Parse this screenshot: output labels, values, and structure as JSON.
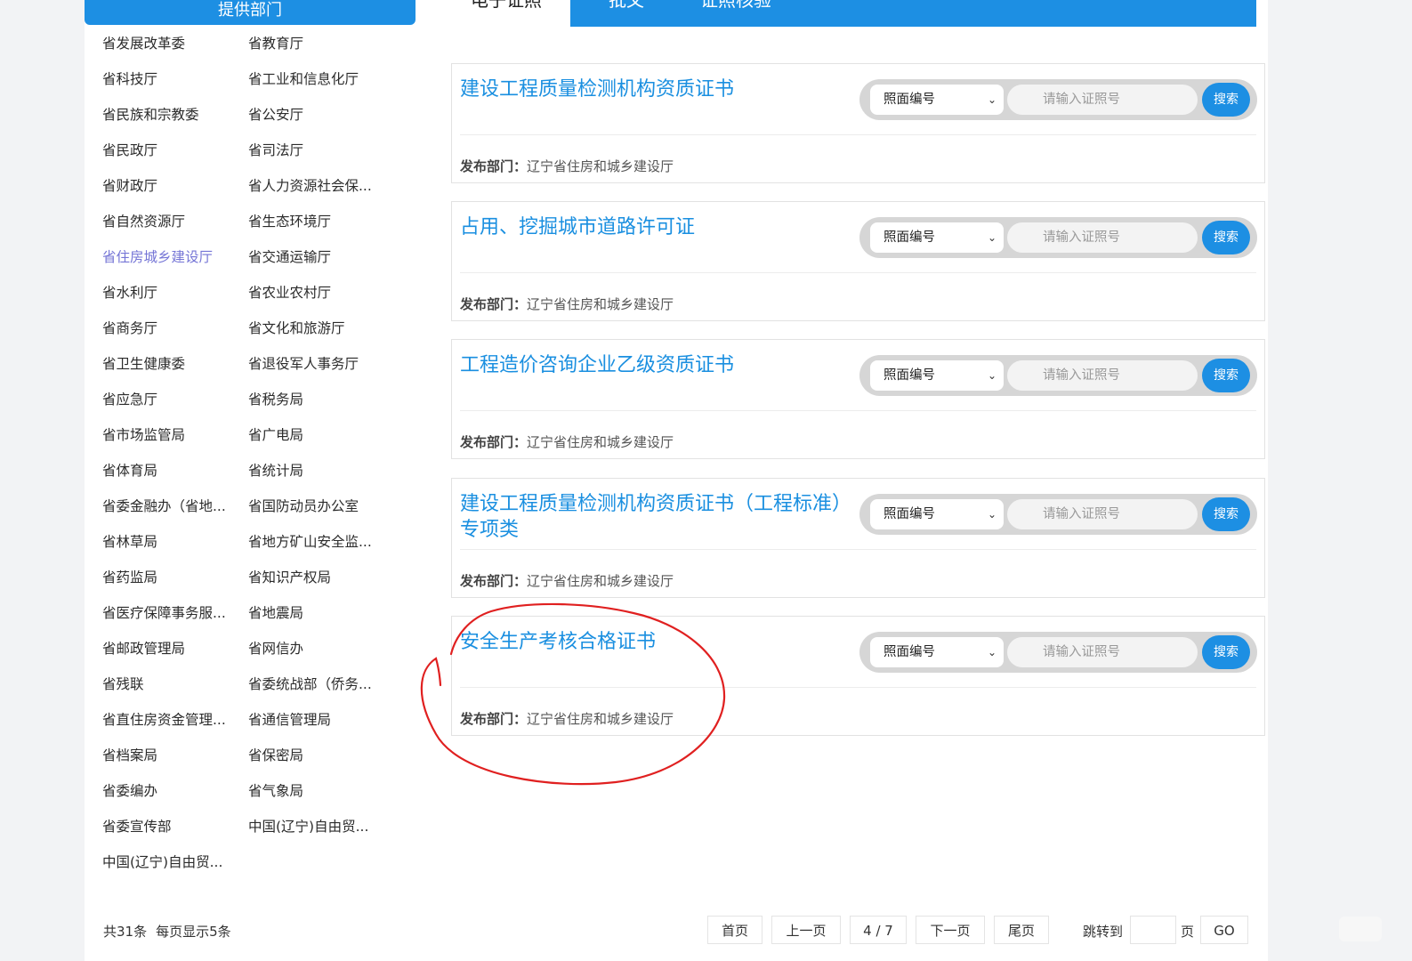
{
  "left_panel": {
    "header": "提供部门",
    "departments": [
      "省发展改革委",
      "省教育厅",
      "省科技厅",
      "省工业和信息化厅",
      "省民族和宗教委",
      "省公安厅",
      "省民政厅",
      "省司法厅",
      "省财政厅",
      "省人力资源社会保...",
      "省自然资源厅",
      "省生态环境厅",
      "省住房城乡建设厅",
      "省交通运输厅",
      "省水利厅",
      "省农业农村厅",
      "省商务厅",
      "省文化和旅游厅",
      "省卫生健康委",
      "省退役军人事务厅",
      "省应急厅",
      "省税务局",
      "省市场监管局",
      "省广电局",
      "省体育局",
      "省统计局",
      "省委金融办（省地...",
      "省国防动员办公室",
      "省林草局",
      "省地方矿山安全监...",
      "省药监局",
      "省知识产权局",
      "省医疗保障事务服...",
      "省地震局",
      "省邮政管理局",
      "省网信办",
      "省残联",
      "省委统战部（侨务...",
      "省直住房资金管理...",
      "省通信管理局",
      "省档案局",
      "省保密局",
      "省委编办",
      "省气象局",
      "省委宣传部",
      "中国(辽宁)自由贸...",
      "中国(辽宁)自由贸..."
    ],
    "active_index": 12
  },
  "tabs": [
    "电子证照",
    "批文",
    "证照核验"
  ],
  "cards": [
    {
      "title": "建设工程质量检测机构资质证书",
      "select": "照面编号",
      "placeholder": "请输入证照号",
      "button": "搜索",
      "dept_label": "发布部门：",
      "dept": "辽宁省住房和城乡建设厅"
    },
    {
      "title": "占用、挖掘城市道路许可证",
      "select": "照面编号",
      "placeholder": "请输入证照号",
      "button": "搜索",
      "dept_label": "发布部门：",
      "dept": "辽宁省住房和城乡建设厅"
    },
    {
      "title": "工程造价咨询企业乙级资质证书",
      "select": "照面编号",
      "placeholder": "请输入证照号",
      "button": "搜索",
      "dept_label": "发布部门：",
      "dept": "辽宁省住房和城乡建设厅"
    },
    {
      "title": "建设工程质量检测机构资质证书（工程标准）专项类",
      "select": "照面编号",
      "placeholder": "请输入证照号",
      "button": "搜索",
      "dept_label": "发布部门：",
      "dept": "辽宁省住房和城乡建设厅"
    },
    {
      "title": "安全生产考核合格证书",
      "select": "照面编号",
      "placeholder": "请输入证照号",
      "button": "搜索",
      "dept_label": "发布部门：",
      "dept": "辽宁省住房和城乡建设厅"
    }
  ],
  "footer": {
    "total": "共31条",
    "per_page": "每页显示5条",
    "first": "首页",
    "prev": "上一页",
    "page_indicator": "4 / 7",
    "next": "下一页",
    "last": "尾页",
    "jump_label": "跳转到",
    "page_unit": "页",
    "go": "GO"
  },
  "colors": {
    "accent": "#1d8fe3",
    "title": "#1a8fe0",
    "active_dept": "#7575d6",
    "annotation": "#e02020"
  }
}
